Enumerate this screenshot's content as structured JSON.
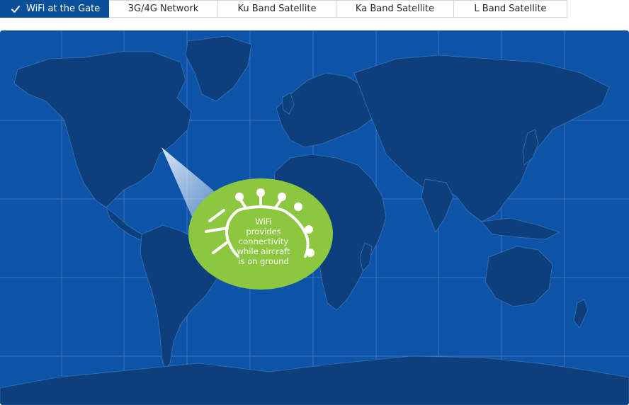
{
  "tabs": [
    {
      "label": "WiFi at the Gate",
      "active": true
    },
    {
      "label": "3G/4G Network",
      "active": false
    },
    {
      "label": "Ku Band Satellite",
      "active": false
    },
    {
      "label": "Ka Band Satellite",
      "active": false
    },
    {
      "label": "L Band Satellite",
      "active": false
    }
  ],
  "callout": {
    "lines": [
      "WiFi",
      "provides",
      "connectivity",
      "while aircraft",
      "is on ground"
    ]
  },
  "colors": {
    "active_tab": "#0b4f98",
    "ocean": "#0d53a7",
    "land": "#0e3f7d",
    "callout": "#8dc63f"
  },
  "icons": {
    "tab_check": "check-icon",
    "callout_graphic": "airport-gate-icon"
  }
}
